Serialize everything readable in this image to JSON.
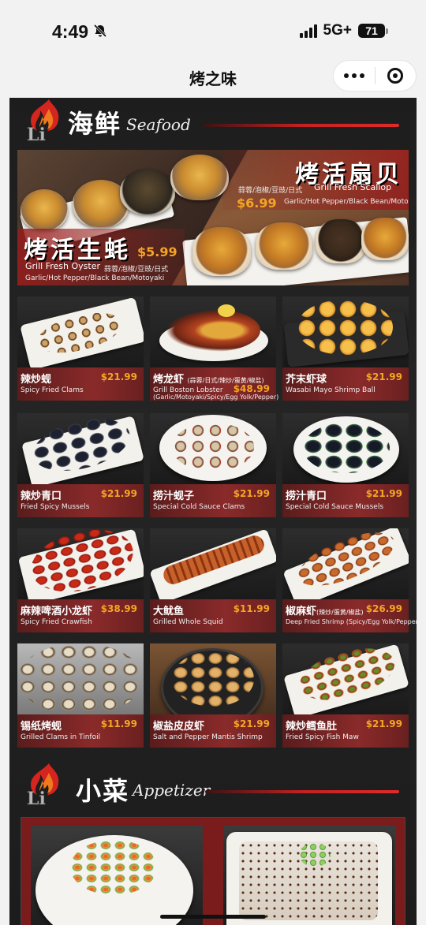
{
  "status_bar": {
    "time": "4:49",
    "network": "5G+",
    "battery": "71"
  },
  "nav": {
    "title": "烤之味"
  },
  "seafood_section": {
    "title_cn": "海鲜",
    "title_en": "Seafood",
    "banner": {
      "oyster": {
        "title": "烤活生蚝",
        "price": "$5.99",
        "name_en": "Grill Fresh Oyster",
        "flavors_cn": "蒜蓉/泡椒/豆豉/日式",
        "flavors_en": "Garlic/Hot Pepper/Black Bean/Motoyaki"
      },
      "scallop": {
        "title": "烤活扇贝",
        "price": "$6.99",
        "name_en": "Grill Fresh Scallop",
        "flavors_cn": "蒜蓉/泡椒/豆豉/日式",
        "flavors_en": "Garlic/Hot Pepper/Black Bean/Motoyaki"
      }
    },
    "items": [
      {
        "cn": "辣炒蚬",
        "cn_note": "",
        "en": "Spicy Fried Clams",
        "en2": "",
        "price": "$21.99"
      },
      {
        "cn": "烤龙虾",
        "cn_note": "(蒜蓉/日式/辣炒/蛋黄/椒盐)",
        "en": "Grill Boston Lobster",
        "en2": "(Garlic/Motoyaki/Spicy/Egg Yolk/Pepper)",
        "price": "$48.99"
      },
      {
        "cn": "芥末虾球",
        "cn_note": "",
        "en": "Wasabi Mayo Shrimp Ball",
        "en2": "",
        "price": "$21.99"
      },
      {
        "cn": "辣炒青口",
        "cn_note": "",
        "en": "Fried Spicy Mussels",
        "en2": "",
        "price": "$21.99"
      },
      {
        "cn": "捞汁蚬子",
        "cn_note": "",
        "en": "Special Cold Sauce Clams",
        "en2": "",
        "price": "$21.99"
      },
      {
        "cn": "捞汁青口",
        "cn_note": "",
        "en": "Special Cold Sauce Mussels",
        "en2": "",
        "price": "$21.99"
      },
      {
        "cn": "麻辣啤酒小龙虾",
        "cn_note": "",
        "en": "Spicy Fried Crawfish",
        "en2": "",
        "price": "$38.99"
      },
      {
        "cn": "大鱿鱼",
        "cn_note": "",
        "en": "Grilled Whole Squid",
        "en2": "",
        "price": "$11.99"
      },
      {
        "cn": "椒麻虾",
        "cn_note": "(辣炒/蛋黄/椒盐)",
        "en": "Deep Fried Shrimp (Spicy/Egg Yolk/Pepper)",
        "en2": "",
        "price": "$26.99"
      },
      {
        "cn": "锡纸烤蚬",
        "cn_note": "",
        "en": "Grilled Clams in Tinfoil",
        "en2": "",
        "price": "$11.99"
      },
      {
        "cn": "椒盐皮皮虾",
        "cn_note": "",
        "en": "Salt and Pepper Mantis Shrimp",
        "en2": "",
        "price": "$21.99"
      },
      {
        "cn": "辣炒鳕鱼肚",
        "cn_note": "",
        "en": "Fried Spicy Fish Maw",
        "en2": "",
        "price": "$21.99"
      }
    ]
  },
  "appetizer_section": {
    "title_cn": "小菜",
    "title_en": "Appetizer"
  },
  "colors": {
    "accent_red": "#c32121",
    "price_gold": "#f5a623",
    "menu_bg": "#1f1f1f"
  },
  "icons": {
    "mute": "bell-slash-icon",
    "more": "more-dots-icon",
    "close": "mini-program-close-icon",
    "logo": "flame-li-logo"
  }
}
